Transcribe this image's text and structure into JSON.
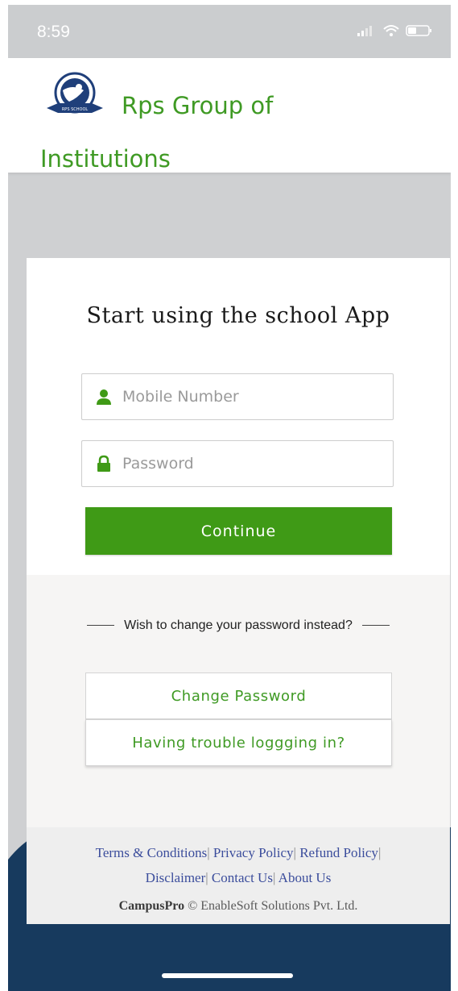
{
  "status": {
    "time": "8:59"
  },
  "header": {
    "logo_text": "RPS SCHOOL",
    "brand": "Rps Group of Institutions"
  },
  "login": {
    "title": "Start using the school App",
    "mobile_placeholder": "Mobile Number",
    "password_placeholder": "Password",
    "continue_label": "Continue",
    "change_prompt": "Wish to change your password instead?",
    "change_password_label": "Change Password",
    "trouble_label": "Having trouble loggging in?"
  },
  "footer": {
    "links": [
      "Terms & Conditions",
      "Privacy Policy",
      "Refund Policy",
      "Disclaimer",
      "Contact Us",
      "About Us"
    ],
    "copyright_brand": "CampusPro",
    "copyright_text": "© EnableSoft Solutions Pvt. Ltd."
  },
  "colors": {
    "accent_green": "#3f9a16",
    "link_blue": "#3b4d9c",
    "wave_navy": "#173a5e"
  }
}
